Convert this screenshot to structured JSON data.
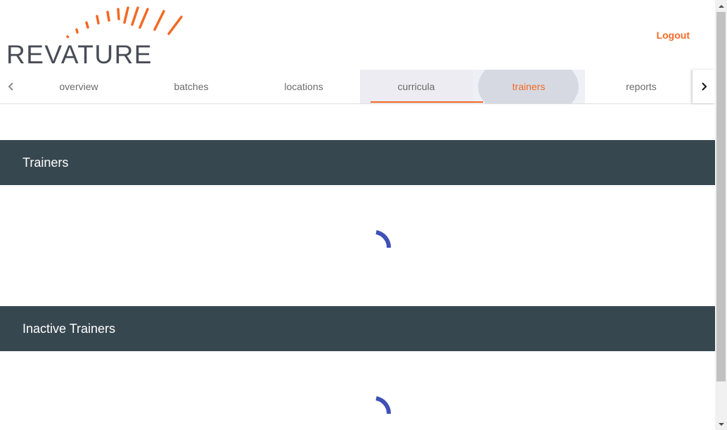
{
  "header": {
    "logo": {
      "text": "REVATURE",
      "icon": "sunburst-logo-icon"
    },
    "logout_label": "Logout"
  },
  "nav": {
    "prev_icon": "chevron-left-icon",
    "next_icon": "chevron-right-icon",
    "tabs": [
      {
        "label": "overview"
      },
      {
        "label": "batches"
      },
      {
        "label": "locations"
      },
      {
        "label": "curricula"
      },
      {
        "label": "trainers"
      },
      {
        "label": "reports"
      }
    ],
    "active_tab": "curricula",
    "highlighted_tab": "trainers"
  },
  "sections": [
    {
      "title": "Trainers",
      "loading": true
    },
    {
      "title": "Inactive Trainers",
      "loading": true
    }
  ],
  "colors": {
    "brand_orange": "#f26925",
    "header_dark": "#37474f",
    "spinner_blue": "#3f51b5",
    "logo_gray": "#474c55"
  }
}
